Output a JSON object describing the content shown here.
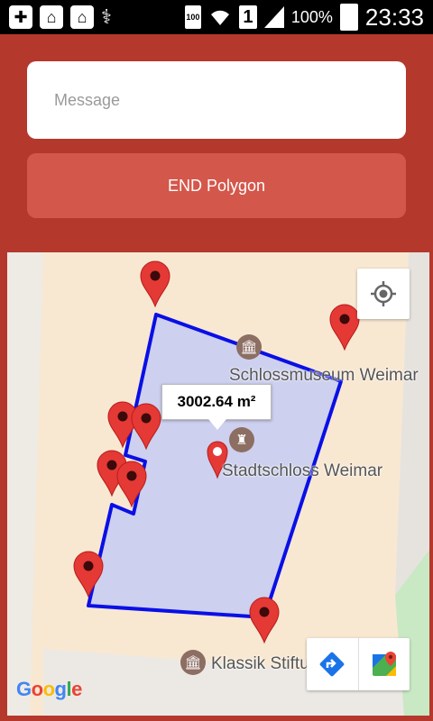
{
  "status_bar": {
    "battery_percent": "100%",
    "time": "23:33",
    "sim_slot": "1",
    "battery_small_label": "100"
  },
  "message_input": {
    "placeholder": "Message",
    "value": ""
  },
  "end_button": {
    "label": "END Polygon"
  },
  "map": {
    "area_label": "3002.64 m²",
    "pois": [
      {
        "name": "Schlossmuseum Weimar"
      },
      {
        "name": "Stadtschloss Weimar"
      },
      {
        "name": "Klassik Stiftung Weimar"
      }
    ],
    "google_logo": "Google"
  },
  "colors": {
    "app_bar": "#b5382d",
    "button": "#d4574b",
    "polygon_stroke": "#0a0fe6",
    "polygon_fill": "#cdd0ee",
    "marker": "#e53935"
  }
}
